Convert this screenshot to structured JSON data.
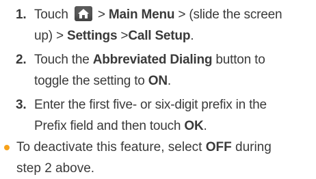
{
  "steps": [
    {
      "number": "1.",
      "line1_pre": "Touch",
      "line1_sep1": ">",
      "line1_b1": "Main Menu",
      "line1_sep2": ">",
      "line1_post": "(slide the screen",
      "line2_pre": "up)",
      "line2_sep1": ">",
      "line2_b1": "Settings",
      "line2_sep2": ">",
      "line2_b2": "Call Setup",
      "line2_post": "."
    },
    {
      "number": "2.",
      "line1_pre": "Touch the",
      "line1_b1": "Abbreviated Dialing",
      "line1_post": "button to",
      "line2_pre": "toggle the setting to",
      "line2_b1": "ON",
      "line2_post": "."
    },
    {
      "number": "3.",
      "line1": "Enter the first five- or six-digit prefix in the",
      "line2_pre": "Prefix field and then touch",
      "line2_b1": "OK",
      "line2_post": "."
    }
  ],
  "bullet": {
    "line1_pre": "To deactivate this feature, select",
    "line1_b1": "OFF",
    "line1_post": "during",
    "line2": "step 2 above."
  },
  "colors": {
    "text": "#3a3a3a",
    "bullet": "#f7a21b",
    "home_icon_bg": "#5b5b5b"
  },
  "icons": {
    "home": "home-icon"
  }
}
